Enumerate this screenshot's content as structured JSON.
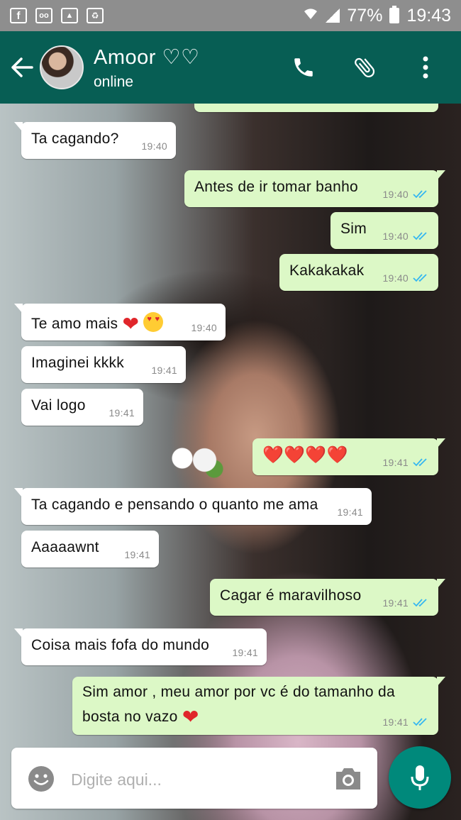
{
  "status_bar": {
    "battery": "77%",
    "time": "19:43",
    "left_icons": [
      "facebook-icon",
      "voicemail-icon",
      "image-icon",
      "recycle-icon"
    ]
  },
  "header": {
    "contact_name": "Amoor ♡♡",
    "contact_status": "online",
    "accent_color": "#075e54"
  },
  "messages": [
    {
      "direction": "in",
      "text": "Ta cagando?",
      "time": "19:40"
    },
    {
      "direction": "out",
      "text": "Antes de ir tomar banho",
      "time": "19:40",
      "read": true
    },
    {
      "direction": "out",
      "text": "Sim",
      "time": "19:40",
      "read": true
    },
    {
      "direction": "out",
      "text": "Kakakakak",
      "time": "19:40",
      "read": true
    },
    {
      "direction": "in",
      "text": "Te amo mais",
      "time": "19:40",
      "emoji": [
        "red-heart",
        "heart-eyes"
      ]
    },
    {
      "direction": "in",
      "text": "Imaginei kkkk",
      "time": "19:41"
    },
    {
      "direction": "in",
      "text": "Vai logo",
      "time": "19:41"
    },
    {
      "direction": "out",
      "text": "❤️❤️❤️❤️",
      "time": "19:41",
      "read": true
    },
    {
      "direction": "in",
      "text": "Ta cagando e pensando o quanto me ama",
      "time": "19:41"
    },
    {
      "direction": "in",
      "text": "Aaaaawnt",
      "time": "19:41"
    },
    {
      "direction": "out",
      "text": "Cagar é maravilhoso",
      "time": "19:41",
      "read": true
    },
    {
      "direction": "in",
      "text": "Coisa mais fofa do mundo",
      "time": "19:41"
    },
    {
      "direction": "out",
      "text_line1": "Sim amor , meu amor por vc é do tamanho da",
      "text_line2": "bosta no vazo",
      "time": "19:41",
      "read": true,
      "emoji": [
        "red-heart"
      ]
    }
  ],
  "composer": {
    "placeholder": "Digite aqui..."
  },
  "colors": {
    "outgoing_bubble": "#dcf8c6",
    "incoming_bubble": "#ffffff",
    "read_tick": "#34b7f1",
    "mic_button": "#00897b"
  }
}
